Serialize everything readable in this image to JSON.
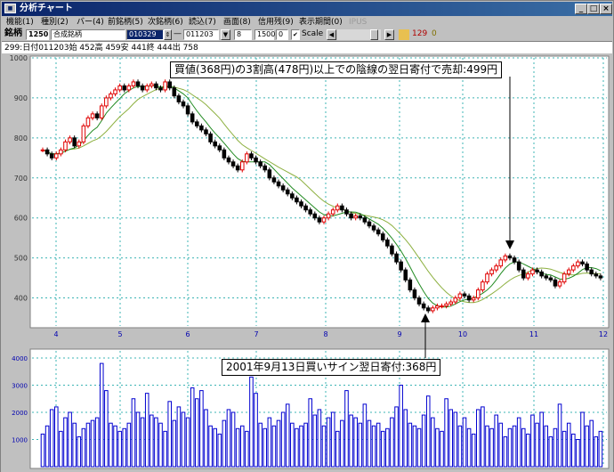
{
  "window": {
    "title": "分析チャート",
    "app_icon": "app-icon",
    "controls": [
      "_",
      "□",
      "×"
    ]
  },
  "menu": [
    {
      "label": "機能(1)",
      "disabled": false
    },
    {
      "label": "種別(2)",
      "disabled": false
    },
    {
      "label": "バー(4)",
      "disabled": false
    },
    {
      "label": "前銘柄(5)",
      "disabled": false
    },
    {
      "label": "次銘柄(6)",
      "disabled": false
    },
    {
      "label": "読込(7)",
      "disabled": false
    },
    {
      "label": "画面(8)",
      "disabled": false
    },
    {
      "label": "信用残(9)",
      "disabled": false
    },
    {
      "label": "表示期間(0)",
      "disabled": false
    },
    {
      "label": "IPUS",
      "disabled": true
    }
  ],
  "toolbar": {
    "code_label": "銘柄",
    "code_value": "1250",
    "name_value": "合成銘柄",
    "date_from": "010329",
    "separator": "—",
    "date_to": "011203",
    "period_value": "8",
    "count_value": "1500",
    "offset_value": "0",
    "scale_checked": "✔",
    "scale_label": "Scale",
    "num1": "129",
    "num2": "0"
  },
  "info": "299:日付011203始 452高 459安 441終 444出 758",
  "colors": {
    "grid": "#3cb4b4",
    "up_candle": "#e00000",
    "down_candle": "#000000",
    "ma_short": "#228b22",
    "ma_long": "#8db040",
    "volume": "#0000d0",
    "axis_text": "#0000b0"
  },
  "annotations": {
    "sell": "買値(368円)の3割高(478円)以上での陰線の翌日寄付で売却:499円",
    "buy": "2001年9月13日買いサイン翌日寄付:368円"
  },
  "chart_data": [
    {
      "type": "candlestick",
      "ylim": [
        330,
        1000
      ],
      "yticks": [
        400,
        500,
        600,
        700,
        800,
        900,
        1000
      ],
      "xticks": [
        "4",
        "5",
        "6",
        "7",
        "8",
        "9",
        "10",
        "11",
        "12"
      ],
      "grid": true,
      "series": [
        {
          "name": "price",
          "close": [
            770,
            760,
            750,
            760,
            770,
            790,
            800,
            780,
            790,
            830,
            850,
            860,
            850,
            880,
            900,
            910,
            920,
            930,
            920,
            930,
            940,
            930,
            920,
            930,
            935,
            925,
            920,
            940,
            925,
            905,
            890,
            880,
            860,
            840,
            830,
            820,
            810,
            790,
            780,
            770,
            750,
            740,
            730,
            720,
            740,
            760,
            750,
            740,
            730,
            720,
            700,
            690,
            680,
            670,
            660,
            650,
            640,
            630,
            620,
            610,
            600,
            590,
            600,
            610,
            620,
            630,
            620,
            610,
            600,
            605,
            600,
            590,
            580,
            570,
            560,
            545,
            530,
            510,
            490,
            470,
            445,
            420,
            400,
            385,
            375,
            368,
            375,
            380,
            380,
            385,
            390,
            400,
            410,
            405,
            395,
            400,
            420,
            440,
            460,
            470,
            480,
            495,
            505,
            500,
            490,
            470,
            450,
            460,
            470,
            465,
            455,
            450,
            445,
            430,
            440,
            460,
            470,
            480,
            490,
            485,
            470,
            460,
            455,
            450
          ]
        },
        {
          "name": "ma-short",
          "values": []
        },
        {
          "name": "ma-long",
          "values": []
        }
      ]
    },
    {
      "type": "bar",
      "ylim": [
        0,
        4000
      ],
      "yticks": [
        1000,
        2000,
        3000,
        4000
      ],
      "series": [
        {
          "name": "volume",
          "values": [
            1200,
            1500,
            2100,
            2200,
            1300,
            1800,
            2000,
            1600,
            1100,
            1400,
            1600,
            1700,
            1800,
            3800,
            2800,
            1600,
            1500,
            1300,
            1400,
            1600,
            2500,
            2000,
            1800,
            2700,
            1900,
            1800,
            1600,
            1300,
            2400,
            1700,
            2200,
            2000,
            1800,
            2900,
            2500,
            2800,
            2100,
            1500,
            1400,
            1200,
            1700,
            2100,
            2000,
            1400,
            1500,
            1300,
            3300,
            2700,
            1600,
            1400,
            1800,
            1500,
            1700,
            2000,
            2300,
            1600,
            1400,
            1500,
            1600,
            2500,
            1900,
            2100,
            1500,
            1800,
            2000,
            1300,
            1700,
            2800,
            1900,
            1800,
            1600,
            2300,
            1700,
            1500,
            1600,
            1300,
            1400,
            1800,
            2200,
            3000,
            2100,
            1600,
            1500,
            1400,
            1900,
            2600,
            1800,
            1400,
            1300,
            2500,
            2100,
            2000,
            1500,
            1800,
            1400,
            1200,
            2100,
            2200,
            1500,
            1400,
            1900,
            1600,
            1100,
            1400,
            1500,
            1800,
            1400,
            1200,
            1900,
            1600,
            2000,
            1500,
            1100,
            1400,
            2300,
            1300,
            1600,
            1200,
            1000,
            2000,
            1500,
            1700,
            1100,
            1300
          ]
        }
      ]
    }
  ]
}
